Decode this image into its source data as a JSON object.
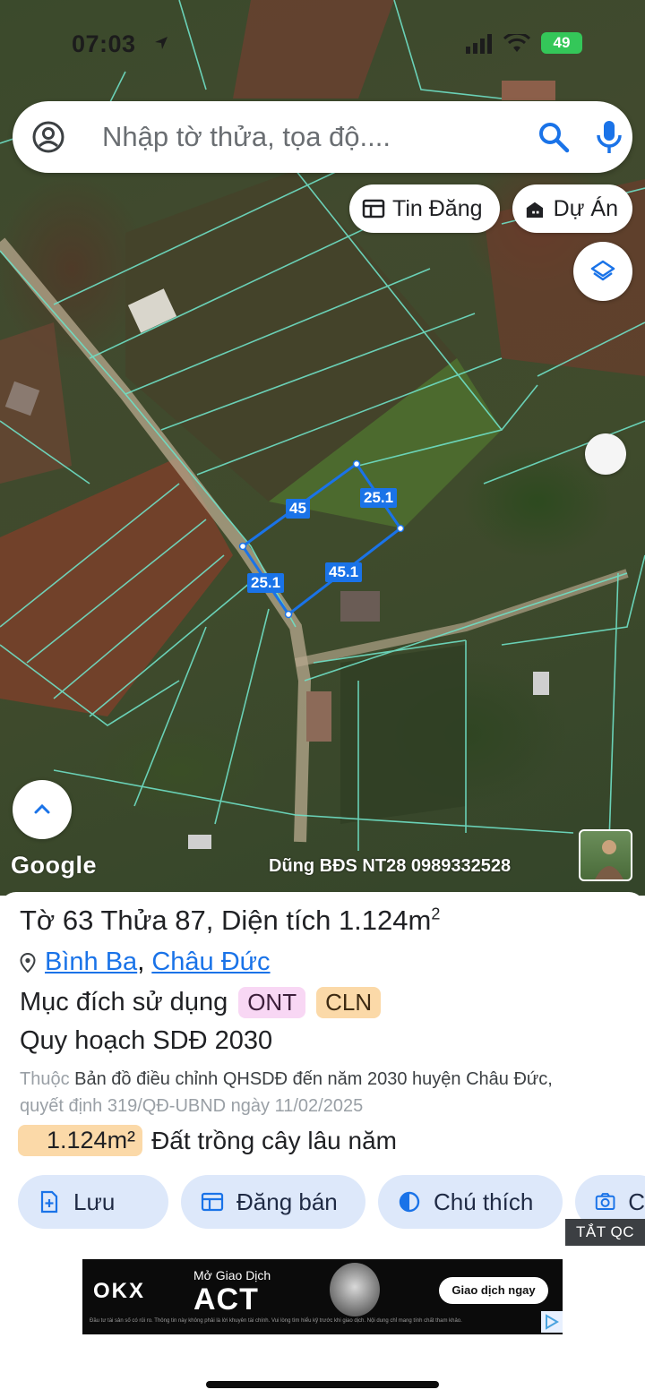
{
  "status_bar": {
    "time": "07:03",
    "battery": "49"
  },
  "search": {
    "placeholder": "Nhập tờ thửa, tọa độ...."
  },
  "chips": {
    "tin_dang": "Tin Đăng",
    "du_an": "Dự Án"
  },
  "map": {
    "dimensions": [
      "45",
      "25.1",
      "45.1",
      "25.1"
    ],
    "logo": "Google",
    "watermark": "Dũng BĐS NT28 0989332528",
    "parcel_outline_color": "#1a73e8",
    "boundary_color": "#6fe0c6"
  },
  "parcel": {
    "to_label": "Tờ",
    "to_number": "63",
    "thua_label": "Thửa",
    "thua_number": "87",
    "area_label": "Diện tích",
    "area_value": "1.124m",
    "area_sup": "2",
    "ward": "Bình Ba",
    "district": "Châu Đức",
    "purpose_label": "Mục đích sử dụng",
    "tags": [
      "ONT",
      "CLN"
    ],
    "plan_title": "Quy hoạch SDĐ 2030",
    "plan_prefix": "Thuộc",
    "plan_desc": "Bản đồ điều chỉnh QHSDĐ đến năm 2030 huyện Châu Đức,",
    "plan_decision": "quyết định 319/QĐ-UBND ngày 11/02/2025",
    "area_badge": "1.124m²",
    "land_type": "Đất trồng cây lâu năm"
  },
  "actions": {
    "save": "Lưu",
    "post_sale": "Đăng bán",
    "legend": "Chú thích",
    "camera": "C"
  },
  "ad": {
    "close_label": "TẮT QC",
    "brand": "OKX",
    "headline_small": "Mở Giao Dịch",
    "headline_big": "ACT",
    "cta": "Giao dịch ngay",
    "fine_print": "Đầu tư tài sản số có rủi ro. Thông tin này không phải là lời khuyên tài chính. Vui lòng tìm hiểu kỹ trước khi giao dịch. Nội dung chỉ mang tính chất tham khảo."
  }
}
